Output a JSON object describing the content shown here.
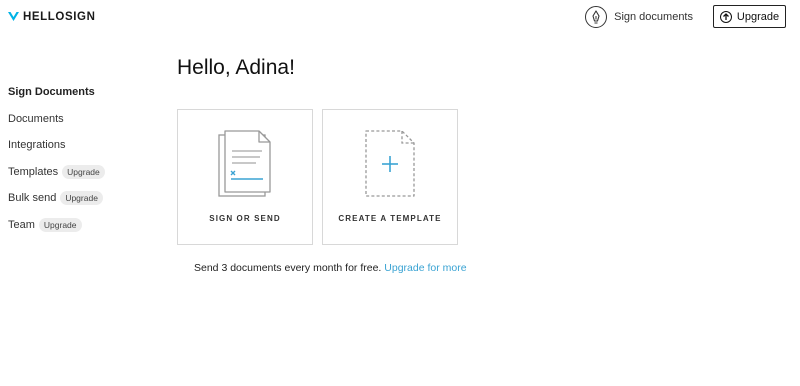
{
  "brand": {
    "name": "HELLOSIGN",
    "accent": "#00b3e6"
  },
  "header": {
    "sign_documents_label": "Sign documents",
    "upgrade_label": "Upgrade"
  },
  "sidebar": {
    "items": [
      {
        "label": "Sign Documents",
        "badge": "",
        "active": true
      },
      {
        "label": "Documents",
        "badge": ""
      },
      {
        "label": "Integrations",
        "badge": ""
      },
      {
        "label": "Templates",
        "badge": "Upgrade"
      },
      {
        "label": "Bulk send",
        "badge": "Upgrade"
      },
      {
        "label": "Team",
        "badge": "Upgrade"
      }
    ]
  },
  "main": {
    "greeting": "Hello, Adina!",
    "cards": [
      {
        "label": "SIGN OR SEND",
        "icon": "document-sign-icon"
      },
      {
        "label": "CREATE A TEMPLATE",
        "icon": "template-plus-icon"
      }
    ],
    "footer": {
      "text": "Send 3 documents every month for free.",
      "link": "Upgrade for more"
    }
  }
}
